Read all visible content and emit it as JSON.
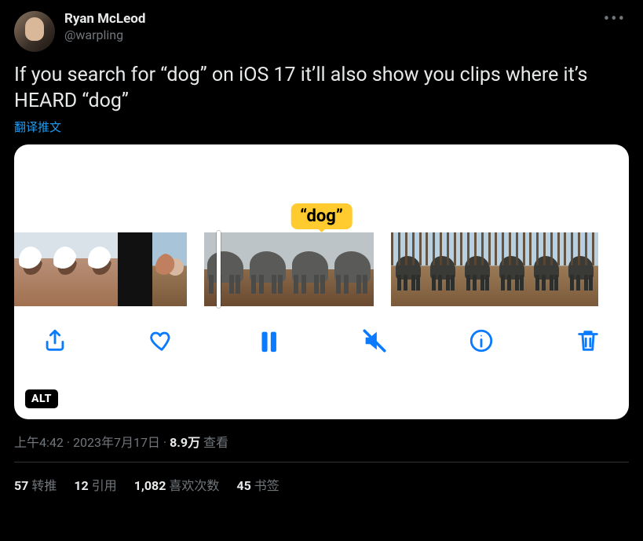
{
  "author": {
    "display_name": "Ryan McLeod",
    "handle": "@warpling"
  },
  "body": "If you search for “dog” on iOS 17 it’ll also show you clips where it’s HEARD “dog”",
  "translate_label": "翻译推文",
  "media": {
    "tooltip": "“dog”",
    "alt_badge": "ALT"
  },
  "meta": {
    "time": "上午4:42",
    "sep1": " · ",
    "date": "2023年7月17日",
    "sep2": " · ",
    "views_num": "8.9万",
    "views_label": " 查看"
  },
  "stats": {
    "retweets_num": "57",
    "retweets_label": "转推",
    "quotes_num": "12",
    "quotes_label": "引用",
    "likes_num": "1,082",
    "likes_label": "喜欢次数",
    "bookmarks_num": "45",
    "bookmarks_label": "书签"
  }
}
